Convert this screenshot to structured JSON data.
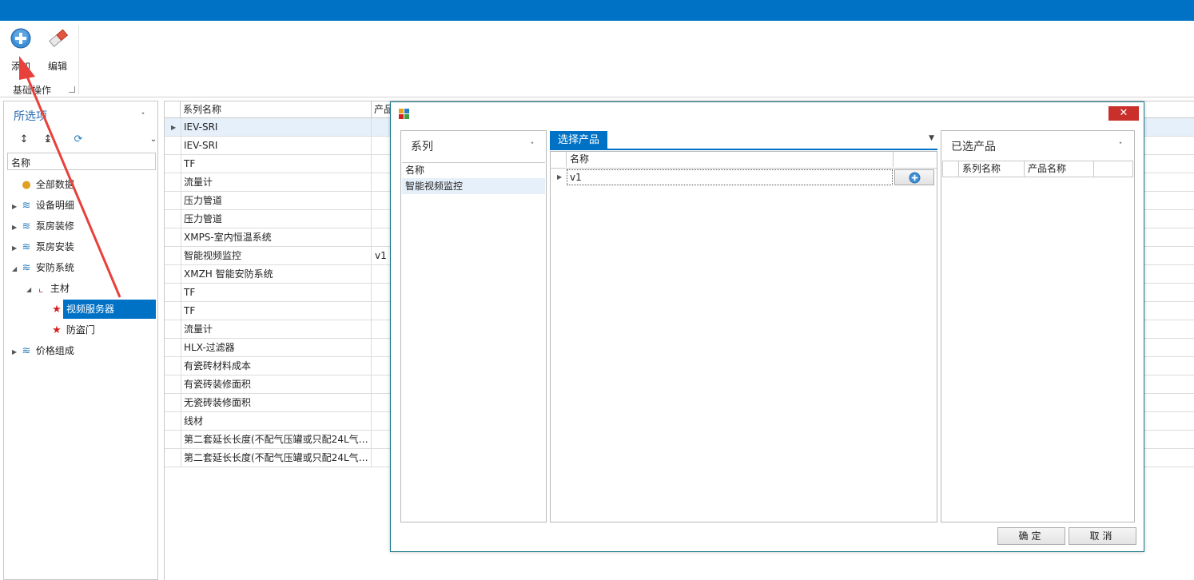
{
  "ribbon": {
    "add_label": "添加",
    "edit_label": "编辑",
    "group_label": "基础操作"
  },
  "left_panel": {
    "title": "所选项",
    "column_header": "名称",
    "tree": [
      {
        "label": "全部数据",
        "icon": "coins-icon"
      },
      {
        "label": "设备明细",
        "icon": "layers-icon"
      },
      {
        "label": "泵房装修",
        "icon": "layers-icon"
      },
      {
        "label": "泵房安装",
        "icon": "layers-icon"
      },
      {
        "label": "安防系统",
        "icon": "layers-icon"
      },
      {
        "label": "主材",
        "icon": "hierarchy-icon"
      },
      {
        "label": "视频服务器",
        "icon": "star-icon"
      },
      {
        "label": "防盗门",
        "icon": "star-icon"
      },
      {
        "label": "价格组成",
        "icon": "layers-icon"
      }
    ]
  },
  "main_grid": {
    "headers": [
      "系列名称",
      "产品"
    ],
    "rows": [
      {
        "name": "IEV-SRI",
        "product": ""
      },
      {
        "name": "IEV-SRI",
        "product": ""
      },
      {
        "name": "TF",
        "product": ""
      },
      {
        "name": "流量计",
        "product": ""
      },
      {
        "name": "压力管道",
        "product": ""
      },
      {
        "name": "压力管道",
        "product": ""
      },
      {
        "name": "XMPS-室内恒温系统",
        "product": ""
      },
      {
        "name": "智能视频监控",
        "product": "v1"
      },
      {
        "name": "XMZH 智能安防系统",
        "product": ""
      },
      {
        "name": "TF",
        "product": ""
      },
      {
        "name": "TF",
        "product": ""
      },
      {
        "name": "流量计",
        "product": ""
      },
      {
        "name": "HLX-过滤器",
        "product": ""
      },
      {
        "name": "有瓷砖材料成本",
        "product": ""
      },
      {
        "name": "有瓷砖装修面积",
        "product": ""
      },
      {
        "name": "无瓷砖装修面积",
        "product": ""
      },
      {
        "name": "线材",
        "product": ""
      },
      {
        "name": "第二套延长长度(不配气压罐或只配24L气…",
        "product": ""
      },
      {
        "name": "第二套延长长度(不配气压罐或只配24L气…",
        "product": ""
      }
    ]
  },
  "dialog": {
    "series_pane": {
      "title": "系列",
      "column_header": "名称",
      "rows": [
        "智能视频监控"
      ]
    },
    "product_pane": {
      "tab_label": "选择产品",
      "column_header": "名称",
      "rows": [
        "v1"
      ]
    },
    "selected_pane": {
      "title": "已选产品",
      "headers": [
        "系列名称",
        "产品名称"
      ]
    },
    "ok_label": "确定",
    "cancel_label": "取消",
    "close_glyph": "✕"
  },
  "colors": {
    "accent": "#0072c6",
    "close": "#c9302c",
    "annotation_arrow": "#e8413c"
  }
}
